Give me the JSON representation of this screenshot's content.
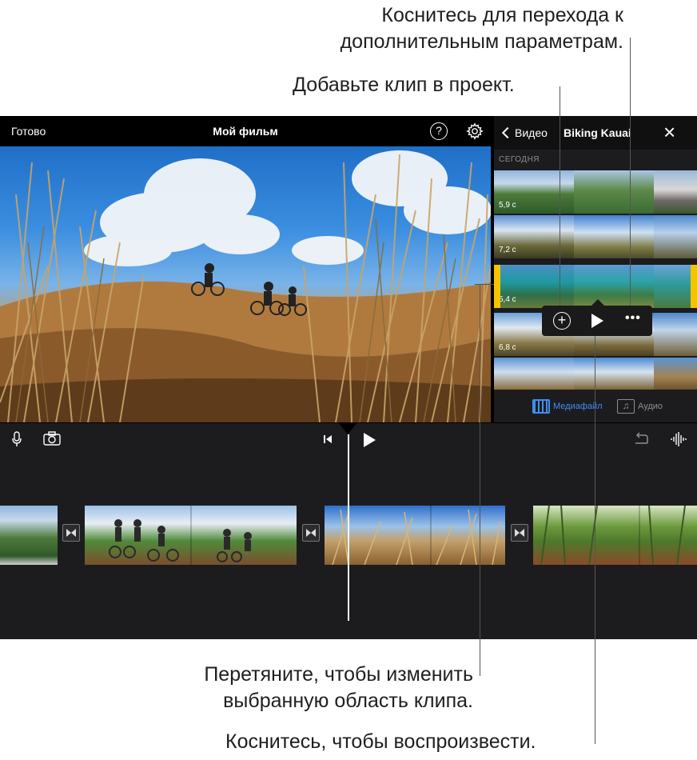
{
  "callouts": {
    "more_options": [
      "Коснитесь для перехода к",
      "дополнительным параметрам."
    ],
    "add_clip": "Добавьте клип в проект.",
    "drag_range": [
      "Перетяните, чтобы изменить",
      "выбранную область клипа."
    ],
    "tap_play": "Коснитесь, чтобы воспроизвести."
  },
  "topbar": {
    "done": "Готово",
    "title": "Мой фильм",
    "help": "?"
  },
  "browser": {
    "back": "Видео",
    "album": "Biking Kauai",
    "close": "×",
    "section": "СЕГОДНЯ",
    "clips": [
      {
        "duration": "5,9 с"
      },
      {
        "duration": "7,2 с"
      },
      {
        "duration": "5,4 с",
        "selected": true
      },
      {
        "duration": "6,8 с"
      },
      {
        "duration": ""
      }
    ],
    "action_bar": {
      "add": "+",
      "more": "•••"
    },
    "tabs": {
      "media": "Медиафайл",
      "audio": "Аудио",
      "audio_glyph": "♫"
    }
  },
  "colors": {
    "selection": "#f5c400",
    "accent": "#3f8ef0"
  }
}
